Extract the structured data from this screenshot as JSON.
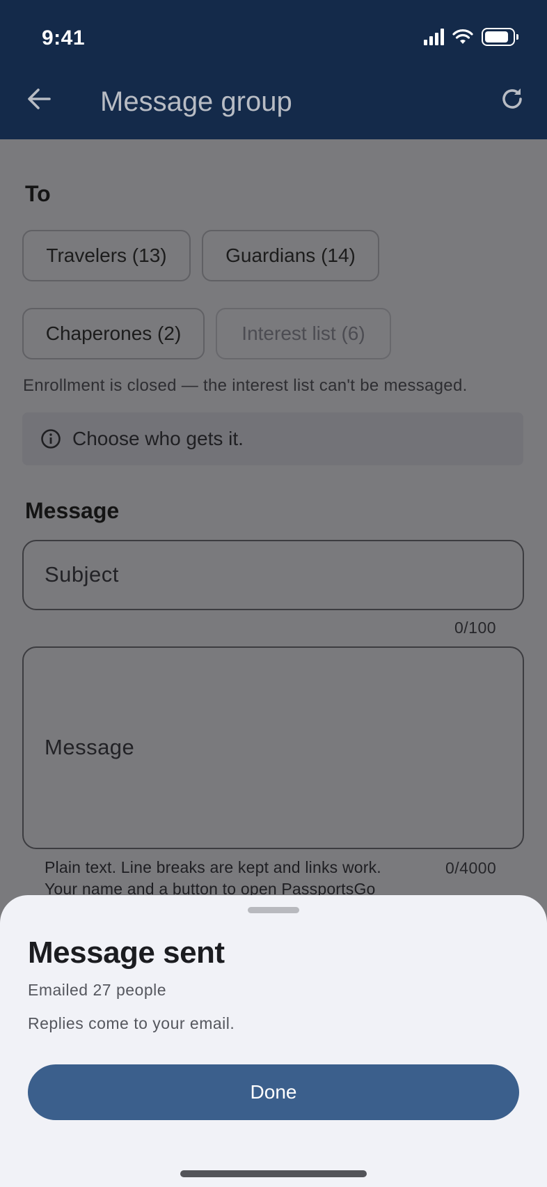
{
  "status_bar": {
    "time": "9:41"
  },
  "app_bar": {
    "title": "Message group"
  },
  "recipients": {
    "label": "To",
    "chips": [
      {
        "label": "Travelers (13)",
        "enabled": true
      },
      {
        "label": "Guardians (14)",
        "enabled": true
      },
      {
        "label": "Chaperones (2)",
        "enabled": true
      },
      {
        "label": "Interest list (6)",
        "enabled": false
      }
    ],
    "closed_note": "Enrollment is closed — the interest list can't be messaged.",
    "info": "Choose who gets it."
  },
  "message": {
    "label": "Message",
    "subject_placeholder": "Subject",
    "subject_counter": "0/100",
    "body_placeholder": "Message",
    "body_counter": "0/4000",
    "helper_line1": "Plain text. Line breaks are kept and links work.",
    "helper_line2": "Your name and a button to open PassportsGo"
  },
  "sheet": {
    "title": "Message sent",
    "subtitle": "Emailed 27 people",
    "note": "Replies come to your email.",
    "done_label": "Done"
  },
  "colors": {
    "app_bar": "#142a4a",
    "scrim_body": "#7a7a7d",
    "sheet_bg": "#f1f2f7",
    "primary_button": "#3b5f8c"
  }
}
